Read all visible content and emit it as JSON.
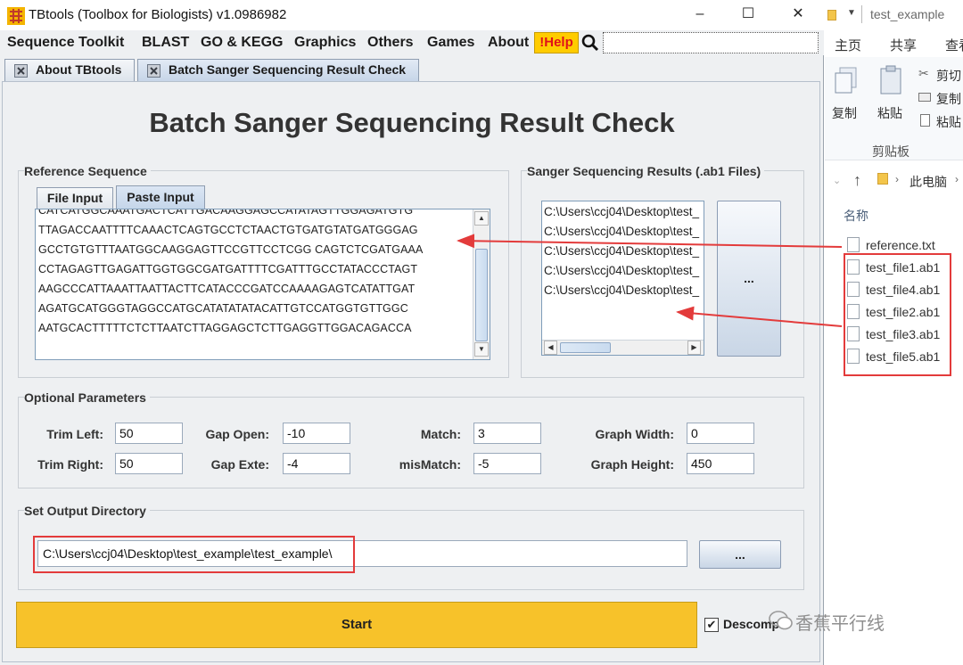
{
  "window": {
    "title": "TBtools (Toolbox for Biologists) v1.0986982",
    "minimize": "–",
    "maximize": "☐",
    "close": "✕"
  },
  "menu": {
    "items": [
      "Sequence Toolkit",
      "BLAST",
      "GO & KEGG",
      "Graphics",
      "Others",
      "Games",
      "About"
    ],
    "help": "!Help"
  },
  "tabs": [
    "About TBtools",
    "Batch Sanger Sequencing Result Check"
  ],
  "page_title": "Batch Sanger Sequencing Result Check",
  "reference": {
    "group_title": "Reference Sequence",
    "subtabs": [
      "File Input",
      "Paste Input"
    ],
    "lines": [
      "CATCATGGCAAATGACTCATTGACAAGGAGCCATATAGTTGGAGATGTG",
      "TTAGACCAATTTTCAAACTCAGTGCCTCTAACTGTGATGTATGATGGGAG",
      "GCCTGTGTTTAATGGCAAGGAGTTCCGTTCCTCGG CAGTCTCGATGAAA",
      "CCTAGAGTTGAGATTGGTGGCGATGATTTTCGATTTGCCTATACCCTAGT",
      "AAGCCCATTAAATTAATTACTTCATACCCGATCCAAAAGAGTCATATTGAT",
      "AGATGCATGGGTAGGCCATGCATATATATACATTGTCCATGGTGTTGGC",
      "AATGCACTTTTTCTCTTAATCTTAGGAGCTCTTGAGGTTGGACAGACCA"
    ]
  },
  "sanger": {
    "group_title": "Sanger Sequencing Results (.ab1 Files)",
    "files": [
      "C:\\Users\\ccj04\\Desktop\\test_",
      "C:\\Users\\ccj04\\Desktop\\test_",
      "C:\\Users\\ccj04\\Desktop\\test_",
      "C:\\Users\\ccj04\\Desktop\\test_",
      "C:\\Users\\ccj04\\Desktop\\test_"
    ],
    "browse_label": "..."
  },
  "params": {
    "group_title": "Optional Parameters",
    "trim_left": {
      "label": "Trim Left:",
      "value": "50"
    },
    "trim_right": {
      "label": "Trim Right:",
      "value": "50"
    },
    "gap_open": {
      "label": "Gap Open:",
      "value": "-10"
    },
    "gap_ext": {
      "label": "Gap Exte:",
      "value": "-4"
    },
    "match": {
      "label": "Match:",
      "value": "3"
    },
    "mismatch": {
      "label": "misMatch:",
      "value": "-5"
    },
    "graph_width": {
      "label": "Graph Width:",
      "value": "0"
    },
    "graph_height": {
      "label": "Graph Height:",
      "value": "450"
    }
  },
  "output": {
    "group_title": "Set Output Directory",
    "path": "C:\\Users\\ccj04\\Desktop\\test_example\\test_example\\",
    "browse_label": "..."
  },
  "start_label": "Start",
  "decompress_label": "Descomp",
  "explorer": {
    "title": "test_example",
    "ribbon_tabs": [
      "主页",
      "共享",
      "查看"
    ],
    "actions": {
      "copy": "复制",
      "paste": "粘贴",
      "cut": "剪切",
      "copy_path": "复制",
      "paste_shortcut": "粘贴"
    },
    "group_label": "剪贴板",
    "address": "此电脑",
    "column_header": "名称",
    "files": [
      "reference.txt",
      "test_file1.ab1",
      "test_file4.ab1",
      "test_file2.ab1",
      "test_file3.ab1",
      "test_file5.ab1"
    ]
  },
  "watermark": "香蕉平行线",
  "colors": {
    "start_button": "#f7c22a",
    "help_bg": "#ffcc00",
    "help_text": "#e0111a",
    "annotation": "#e33b3b"
  }
}
